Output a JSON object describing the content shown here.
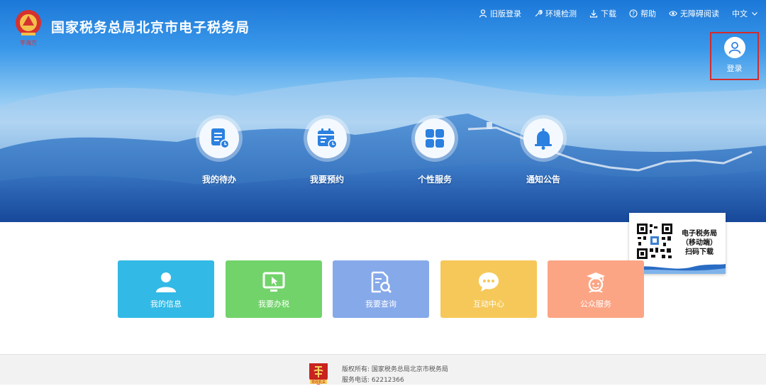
{
  "header": {
    "site_title": "国家税务总局北京市电子税务局",
    "emblem_caption": "字海方"
  },
  "top_nav": {
    "old_login": "旧版登录",
    "env_check": "环境检测",
    "download": "下载",
    "help": "帮助",
    "accessible": "无障碍阅读",
    "language": "中文"
  },
  "login": {
    "label": "登录"
  },
  "circle_buttons": [
    {
      "label": "我的待办",
      "icon": "document-clock-icon"
    },
    {
      "label": "我要预约",
      "icon": "calendar-clock-icon"
    },
    {
      "label": "个性服务",
      "icon": "grid-icon"
    },
    {
      "label": "通知公告",
      "icon": "bell-icon"
    }
  ],
  "qr_card": {
    "line1": "电子税务局",
    "line2": "（移动端）",
    "line3": "扫码下载"
  },
  "tiles": [
    {
      "label": "我的信息",
      "color": "#32b9e6",
      "icon": "user-icon"
    },
    {
      "label": "我要办税",
      "color": "#72d36a",
      "icon": "monitor-cursor-icon"
    },
    {
      "label": "我要查询",
      "color": "#86a9ea",
      "icon": "document-search-icon"
    },
    {
      "label": "互动中心",
      "color": "#f6c859",
      "icon": "chat-icon"
    },
    {
      "label": "公众服务",
      "color": "#fca585",
      "icon": "graduate-icon"
    }
  ],
  "footer": {
    "copyright": "版权所有: 国家税务总局北京市税务局",
    "phone": "服务电话: 62212366",
    "logo_caption": "党政机关"
  },
  "colors": {
    "accent_blue": "#1c78d8",
    "login_highlight": "#d32b2b",
    "icon_blue": "#2b80e0"
  }
}
